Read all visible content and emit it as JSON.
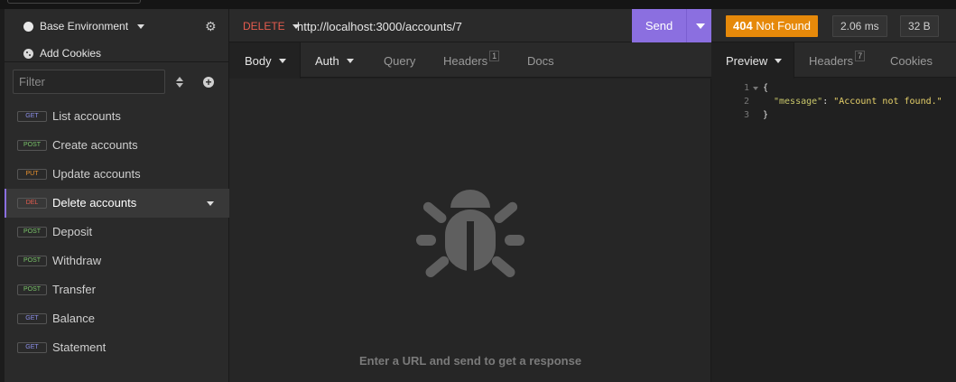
{
  "sidebar": {
    "environment_label": "Base Environment",
    "cookies_label": "Add Cookies",
    "filter_placeholder": "Filter",
    "requests": [
      {
        "method": "GET",
        "label": "List accounts"
      },
      {
        "method": "POST",
        "label": "Create accounts"
      },
      {
        "method": "PUT",
        "label": "Update accounts"
      },
      {
        "method": "DEL",
        "label": "Delete accounts"
      },
      {
        "method": "POST",
        "label": "Deposit"
      },
      {
        "method": "POST",
        "label": "Withdraw"
      },
      {
        "method": "POST",
        "label": "Transfer"
      },
      {
        "method": "GET",
        "label": "Balance"
      },
      {
        "method": "GET",
        "label": "Statement"
      }
    ]
  },
  "request": {
    "method": "DELETE",
    "url": "http://localhost:3000/accounts/7",
    "send_label": "Send",
    "tabs": {
      "body": "Body",
      "auth": "Auth",
      "query": "Query",
      "headers": "Headers",
      "headers_count": "1",
      "docs": "Docs"
    },
    "empty_message": "Enter a URL and send to get a response"
  },
  "response": {
    "status_code": "404",
    "status_text": "Not Found",
    "time": "2.06 ms",
    "size": "32 B",
    "tabs": {
      "preview": "Preview",
      "headers": "Headers",
      "headers_count": "7",
      "cookies": "Cookies"
    },
    "lines": [
      {
        "num": "1",
        "text": "{"
      },
      {
        "num": "2",
        "key": "\"message\"",
        "sep": ": ",
        "value": "\"Account not found.\""
      },
      {
        "num": "3",
        "text": "}"
      }
    ]
  },
  "colors": {
    "accent": "#8b6fe0",
    "status_404": "#e6890a",
    "method_delete": "#e65c4f",
    "method_get": "#8c8fe8",
    "method_post": "#7ac46a",
    "method_put": "#e6902e"
  },
  "icons": [
    "gear-icon",
    "cookie-icon",
    "sort-icon",
    "plus-icon",
    "bug-icon",
    "chevron-down-icon"
  ]
}
